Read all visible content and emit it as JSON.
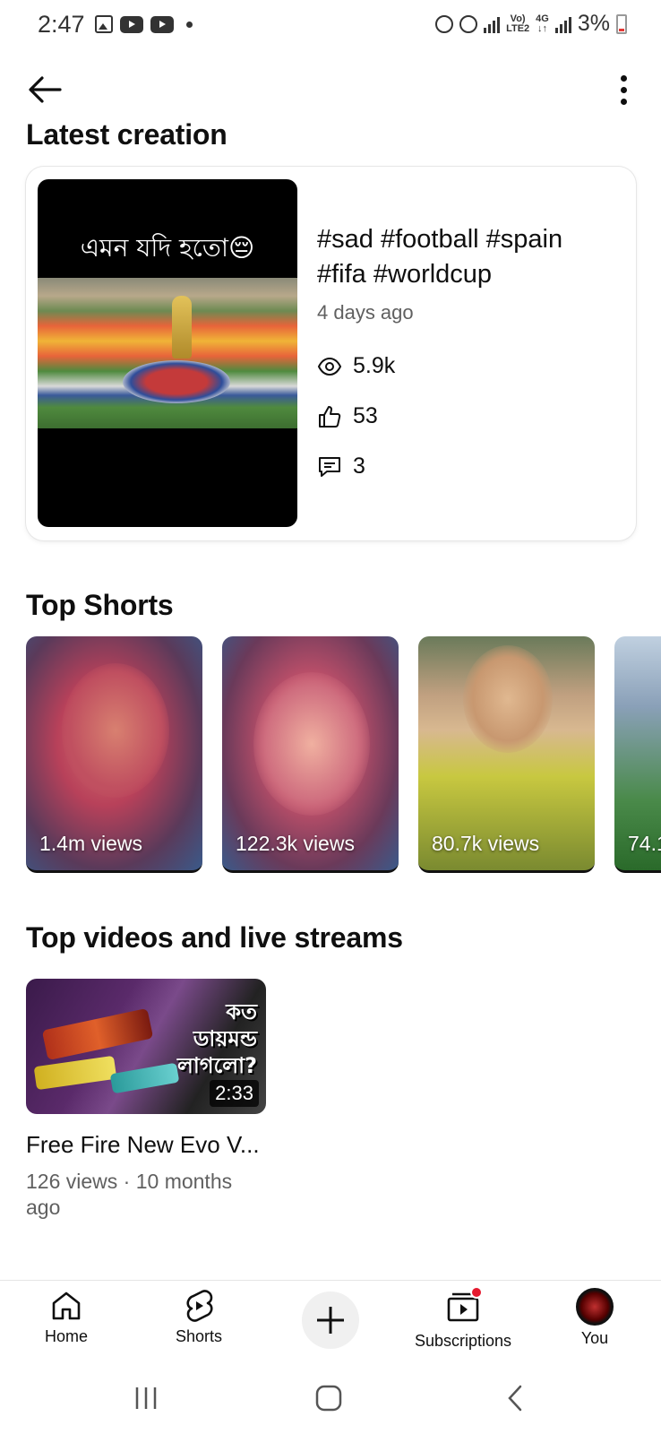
{
  "status_bar": {
    "time": "2:47",
    "network_top": "Vo)",
    "network_bottom": "LTE2",
    "net2_top": "4G",
    "net2_bottom": "↓↑",
    "battery": "3%"
  },
  "latest": {
    "section_title": "Latest creation",
    "thumb_caption": "এমন যদি হতো😔",
    "title": "#sad #football #spain #fifa #worldcup",
    "age": "4 days ago",
    "views": "5.9k",
    "likes": "53",
    "comments": "3"
  },
  "top_shorts": {
    "section_title": "Top Shorts",
    "items": [
      {
        "views": "1.4m views"
      },
      {
        "views": "122.3k views"
      },
      {
        "views": "80.7k views"
      },
      {
        "views": "74.1"
      }
    ]
  },
  "top_videos": {
    "section_title": "Top videos and live streams",
    "items": [
      {
        "thumb_text": "কত\nডায়মন্ড\nলাগলো?",
        "duration": "2:33",
        "title": "Free Fire New Evo V...",
        "meta": "126 views · 10 months ago"
      }
    ]
  },
  "bottom_nav": {
    "home": "Home",
    "shorts": "Shorts",
    "subscriptions": "Subscriptions",
    "you": "You"
  },
  "colors": {
    "notification_dot": "#e5192e",
    "secondary_text": "#606060"
  }
}
